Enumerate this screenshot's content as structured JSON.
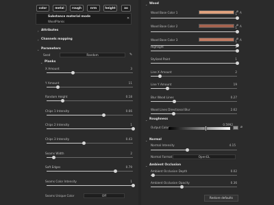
{
  "channels": [
    "color",
    "metal",
    "rough",
    "nrm",
    "height",
    "ao"
  ],
  "material": {
    "title": "Substance material mode",
    "name": "WoodPlanks"
  },
  "left": {
    "attributes": "Attributes",
    "channels_mapping": "Channels mapping",
    "parameters": "Parameters",
    "seed": {
      "label": "Seed",
      "value": "Random"
    },
    "planks_header": "Planks",
    "sliders": [
      {
        "label": "X Amount",
        "value": "3",
        "pct": 0.3
      },
      {
        "label": "Y Amount",
        "value": "11",
        "pct": 0.13
      },
      {
        "label": "Random Height",
        "value": "0.18",
        "pct": 0.18
      },
      {
        "label": "Chips 1 Intensity",
        "value": "0.66",
        "pct": 0.66
      },
      {
        "label": "Chips 2 Intensity",
        "value": "1",
        "pct": 1.0
      },
      {
        "label": "Chips 3 Intensity",
        "value": "0.43",
        "pct": 0.43
      },
      {
        "label": "Seams Width",
        "value": "2",
        "pct": 0.08
      },
      {
        "label": "Soft Edges",
        "value": "0.79",
        "pct": 0.79
      },
      {
        "label": "Seams Color Intensity",
        "value": "1",
        "pct": 1.0
      }
    ],
    "unique_color": {
      "label": "Seams Unique Color",
      "value": "Off"
    }
  },
  "right": {
    "wood_header": "Wood",
    "colors": [
      {
        "label": "Wood Base Color 1",
        "color": "#e0a27e",
        "value": "1",
        "pct": 1.0
      },
      {
        "label": "Wood Base Color 2",
        "color": "#a5634f",
        "value": "1",
        "pct": 1.0
      },
      {
        "label": "Wood Base Color 3",
        "color": "#c17b62",
        "value": "1",
        "pct": 1.0
      }
    ],
    "wood_sliders": [
      {
        "label": "Highlight",
        "value": "1",
        "pct": 1.0
      },
      {
        "label": "Stylized Paint",
        "value": "1",
        "pct": 1.0
      },
      {
        "label": "Line X Amount",
        "value": "2",
        "pct": 0.1
      },
      {
        "label": "Line Y Amount",
        "value": "19",
        "pct": 0.19
      },
      {
        "label": "Blur Wood Lines",
        "value": "0.27",
        "pct": 0.27
      },
      {
        "label": "Wood Lines Directional Blur",
        "value": "2.62",
        "pct": 0.26
      }
    ],
    "roughness_header": "Roughness",
    "output_color": {
      "label": "Output Color",
      "value": "0.5992",
      "pct": 0.6
    },
    "normal_header": "Normal",
    "normal_intensity": {
      "label": "Normal Intensity",
      "value": "4.15",
      "pct": 0.42
    },
    "normal_format": {
      "label": "Normal Format",
      "value": "OpenGL"
    },
    "ao_header": "Ambient Occlusion",
    "ao_sliders": [
      {
        "label": "Ambient Occlusion Depth",
        "value": "0.02",
        "pct": 0.02
      },
      {
        "label": "Ambient Occlusion Opacity",
        "value": "0.36",
        "pct": 0.36
      }
    ],
    "restore": "Restore defaults"
  }
}
